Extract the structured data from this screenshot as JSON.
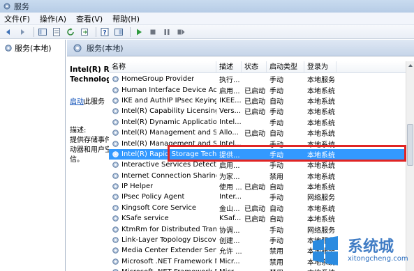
{
  "window": {
    "title": "服务"
  },
  "menu": [
    {
      "label": "文件(F)"
    },
    {
      "label": "操作(A)"
    },
    {
      "label": "查看(V)"
    },
    {
      "label": "帮助(H)"
    }
  ],
  "toolbar_icons": [
    "back-arrow-icon",
    "forward-arrow-icon",
    "console-tree-icon",
    "properties-icon",
    "refresh-icon",
    "export-list-icon",
    "help-icon",
    "mmc-view-icon",
    "start-service-icon",
    "stop-service-icon",
    "pause-service-icon",
    "restart-service-icon"
  ],
  "tree": {
    "label": "服务(本地)"
  },
  "right_header": {
    "label": "服务(本地)"
  },
  "description_panel": {
    "service_name": "Intel(R) Rapid Storage Technology",
    "start_link": "启动",
    "start_suffix": "此服务",
    "desc_label": "描述:",
    "desc_text": "提供存储事件通知并管理存储驱动器和用户空间应用程序间的通信。"
  },
  "columns": [
    "名称",
    "描述",
    "状态",
    "启动类型",
    "登录为"
  ],
  "services": [
    {
      "name": "HomeGroup Provider",
      "desc": "执行...",
      "status": "",
      "start": "手动",
      "logon": "本地服务"
    },
    {
      "name": "Human Interface Device Access",
      "desc": "启用...",
      "status": "已启动",
      "start": "手动",
      "logon": "本地系统"
    },
    {
      "name": "IKE and AuthIP IPsec Keying ...",
      "desc": "IKEE...",
      "status": "已启动",
      "start": "自动",
      "logon": "本地系统"
    },
    {
      "name": "Intel(R) Capability Licensing Se...",
      "desc": "Vers...",
      "status": "已启动",
      "start": "手动",
      "logon": "本地系统"
    },
    {
      "name": "Intel(R) Dynamic Application L...",
      "desc": "Intel...",
      "status": "",
      "start": "手动",
      "logon": "本地系统"
    },
    {
      "name": "Intel(R) Management and Sec...",
      "desc": "Allo...",
      "status": "已启动",
      "start": "自动",
      "logon": "本地系统"
    },
    {
      "name": "Intel(R) Management and Sec...",
      "desc": "Intel...",
      "status": "",
      "start": "手动",
      "logon": "本地系统"
    },
    {
      "name": "Intel(R) Rapid Storage Techno...",
      "desc": "提供...",
      "status": "",
      "start": "手动",
      "logon": "本地系统",
      "selected": true
    },
    {
      "name": "Interactive Services Detection",
      "desc": "启用...",
      "status": "",
      "start": "手动",
      "logon": "本地系统"
    },
    {
      "name": "Internet Connection Sharing (I...",
      "desc": "为家...",
      "status": "",
      "start": "禁用",
      "logon": "本地系统"
    },
    {
      "name": "IP Helper",
      "desc": "使用 ...",
      "status": "已启动",
      "start": "自动",
      "logon": "本地系统"
    },
    {
      "name": "IPsec Policy Agent",
      "desc": "Inter...",
      "status": "",
      "start": "手动",
      "logon": "网络服务"
    },
    {
      "name": "Kingsoft Core Service",
      "desc": "金山...",
      "status": "已启动",
      "start": "自动",
      "logon": "本地系统"
    },
    {
      "name": "KSafe service",
      "desc": "KSaf...",
      "status": "已启动",
      "start": "自动",
      "logon": "本地系统"
    },
    {
      "name": "KtmRm for Distributed Transa...",
      "desc": "协调...",
      "status": "",
      "start": "手动",
      "logon": "网络服务"
    },
    {
      "name": "Link-Layer Topology Discover...",
      "desc": "创建...",
      "status": "",
      "start": "手动",
      "logon": "本地服务"
    },
    {
      "name": "Media Center Extender Service",
      "desc": "允许 ...",
      "status": "",
      "start": "禁用",
      "logon": "本地服务"
    },
    {
      "name": "Microsoft .NET Framework N...",
      "desc": "Micr...",
      "status": "",
      "start": "禁用",
      "logon": "本地系统"
    },
    {
      "name": "Microsoft .NET Framework N...",
      "desc": "Micr...",
      "status": "",
      "start": "禁用",
      "logon": "本地系统"
    }
  ],
  "watermark": {
    "text": "系统城",
    "url": "xitongcheng.com"
  },
  "colors": {
    "selection": "#3399ff",
    "highlight_box": "#e02424",
    "link": "#0d4fb8"
  }
}
